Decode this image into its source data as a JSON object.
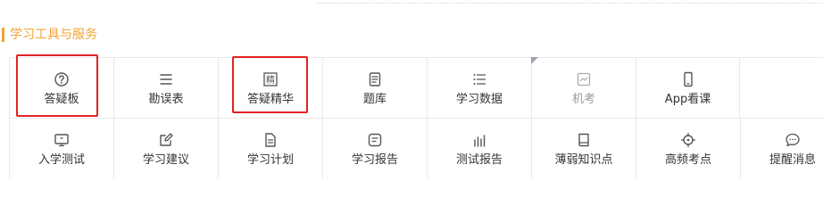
{
  "section": {
    "title": "学习工具与服务"
  },
  "colors": {
    "accent": "#f3a33a",
    "text": "#333333",
    "disabled_text": "#999999",
    "highlight": "#e22222"
  },
  "tools_row1": [
    {
      "label": "答疑板",
      "icon": "question-circle-icon"
    },
    {
      "label": "勘误表",
      "icon": "list-lines-icon"
    },
    {
      "label": "答疑精华",
      "icon": "jing-badge-icon"
    },
    {
      "label": "题库",
      "icon": "document-list-icon"
    },
    {
      "label": "学习数据",
      "icon": "bullet-list-icon"
    },
    {
      "label": "机考",
      "icon": "monitor-chart-icon",
      "state": "disabled"
    },
    {
      "label": "App看课",
      "icon": "mobile-phone-icon"
    }
  ],
  "tools_row2": [
    {
      "label": "入学测试",
      "icon": "monitor-icon"
    },
    {
      "label": "学习建议",
      "icon": "edit-icon"
    },
    {
      "label": "学习计划",
      "icon": "file-text-icon"
    },
    {
      "label": "学习报告",
      "icon": "message-square-icon"
    },
    {
      "label": "测试报告",
      "icon": "bar-chart-icon"
    },
    {
      "label": "薄弱知识点",
      "icon": "book-icon"
    },
    {
      "label": "高频考点",
      "icon": "target-icon"
    },
    {
      "label": "提醒消息",
      "icon": "chat-bubble-icon"
    }
  ],
  "highlighted_items": [
    "答疑板",
    "答疑精华"
  ]
}
